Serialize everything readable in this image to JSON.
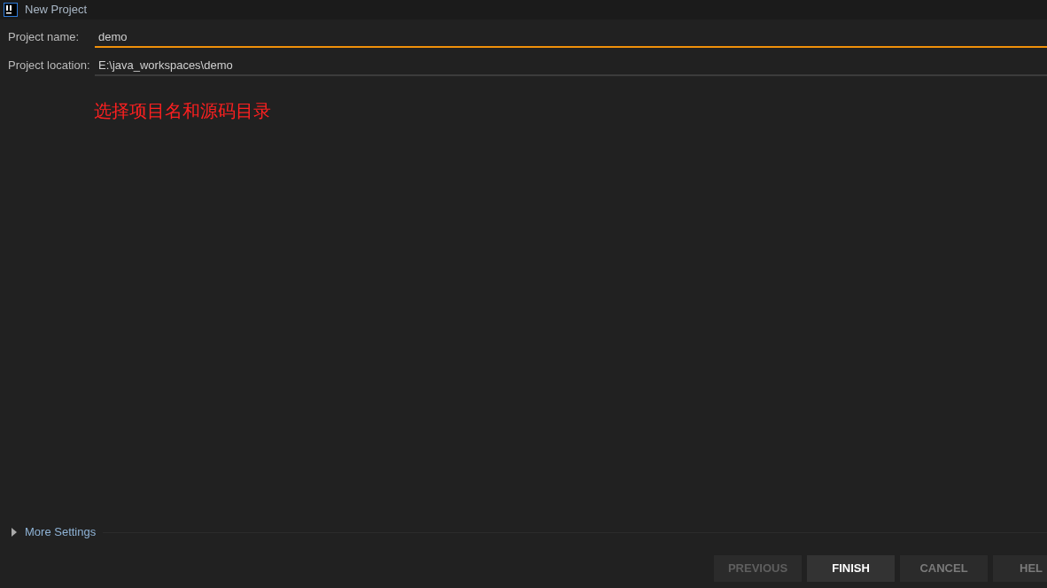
{
  "window": {
    "title": "New Project"
  },
  "fields": [
    {
      "label": "Project name:",
      "value": "demo",
      "focused": true
    },
    {
      "label": "Project location:",
      "value": "E:\\java_workspaces\\demo",
      "focused": false
    }
  ],
  "annotation": "选择项目名和源码目录",
  "more_settings": {
    "label": "More Settings",
    "expanded": false
  },
  "buttons": [
    {
      "label": "PREVIOUS",
      "disabled": true,
      "primary": false
    },
    {
      "label": "FINISH",
      "disabled": false,
      "primary": true
    },
    {
      "label": "CANCEL",
      "disabled": false,
      "primary": false
    },
    {
      "label": "HEL",
      "disabled": false,
      "primary": false
    }
  ]
}
